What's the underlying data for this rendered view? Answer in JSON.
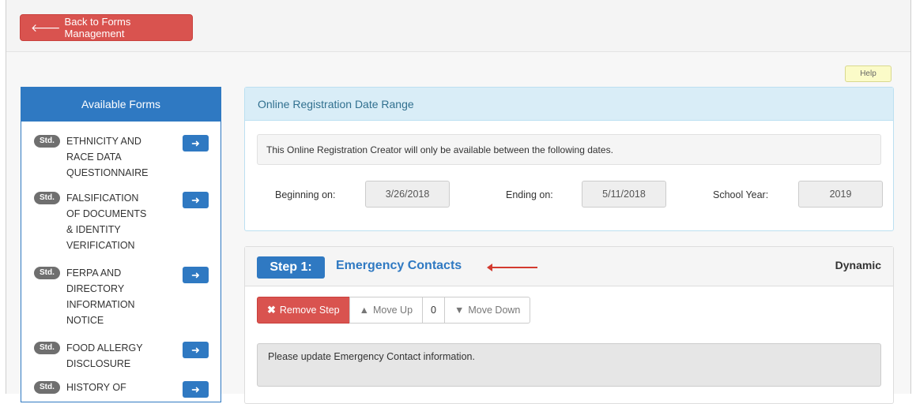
{
  "header": {
    "back_label": "Back to Forms Management",
    "help_label": "Help"
  },
  "sidebar": {
    "title": "Available Forms",
    "badge": "Std.",
    "items": [
      {
        "lines": [
          "ETHNICITY AND",
          "RACE DATA",
          "QUESTIONNAIRE"
        ]
      },
      {
        "lines": [
          "FALSIFICATION",
          "OF DOCUMENTS",
          "& IDENTITY",
          "VERIFICATION"
        ]
      },
      {
        "lines": [
          "FERPA AND",
          "DIRECTORY",
          "INFORMATION",
          "NOTICE"
        ]
      },
      {
        "lines": [
          "FOOD ALLERGY",
          "DISCLOSURE"
        ]
      },
      {
        "lines": [
          "HISTORY OF"
        ]
      }
    ]
  },
  "date_panel": {
    "title": "Online Registration Date Range",
    "info": "This Online Registration Creator will only be available between the following dates.",
    "beginning_label": "Beginning on:",
    "beginning_value": "3/26/2018",
    "ending_label": "Ending on:",
    "ending_value": "5/11/2018",
    "year_label": "School Year:",
    "year_value": "2019"
  },
  "step_panel": {
    "step_label": "Step 1:",
    "title": "Emergency Contacts",
    "type": "Dynamic",
    "remove_label": "Remove Step",
    "move_up_label": "Move Up",
    "order_value": "0",
    "move_down_label": "Move Down",
    "note": "Please update Emergency Contact information."
  },
  "colors": {
    "primary": "#2f79c2",
    "danger": "#d9534f",
    "info_bg": "#d9edf7",
    "help_bg": "#fbfbc8",
    "annotation_arrow": "#d33a2f"
  }
}
